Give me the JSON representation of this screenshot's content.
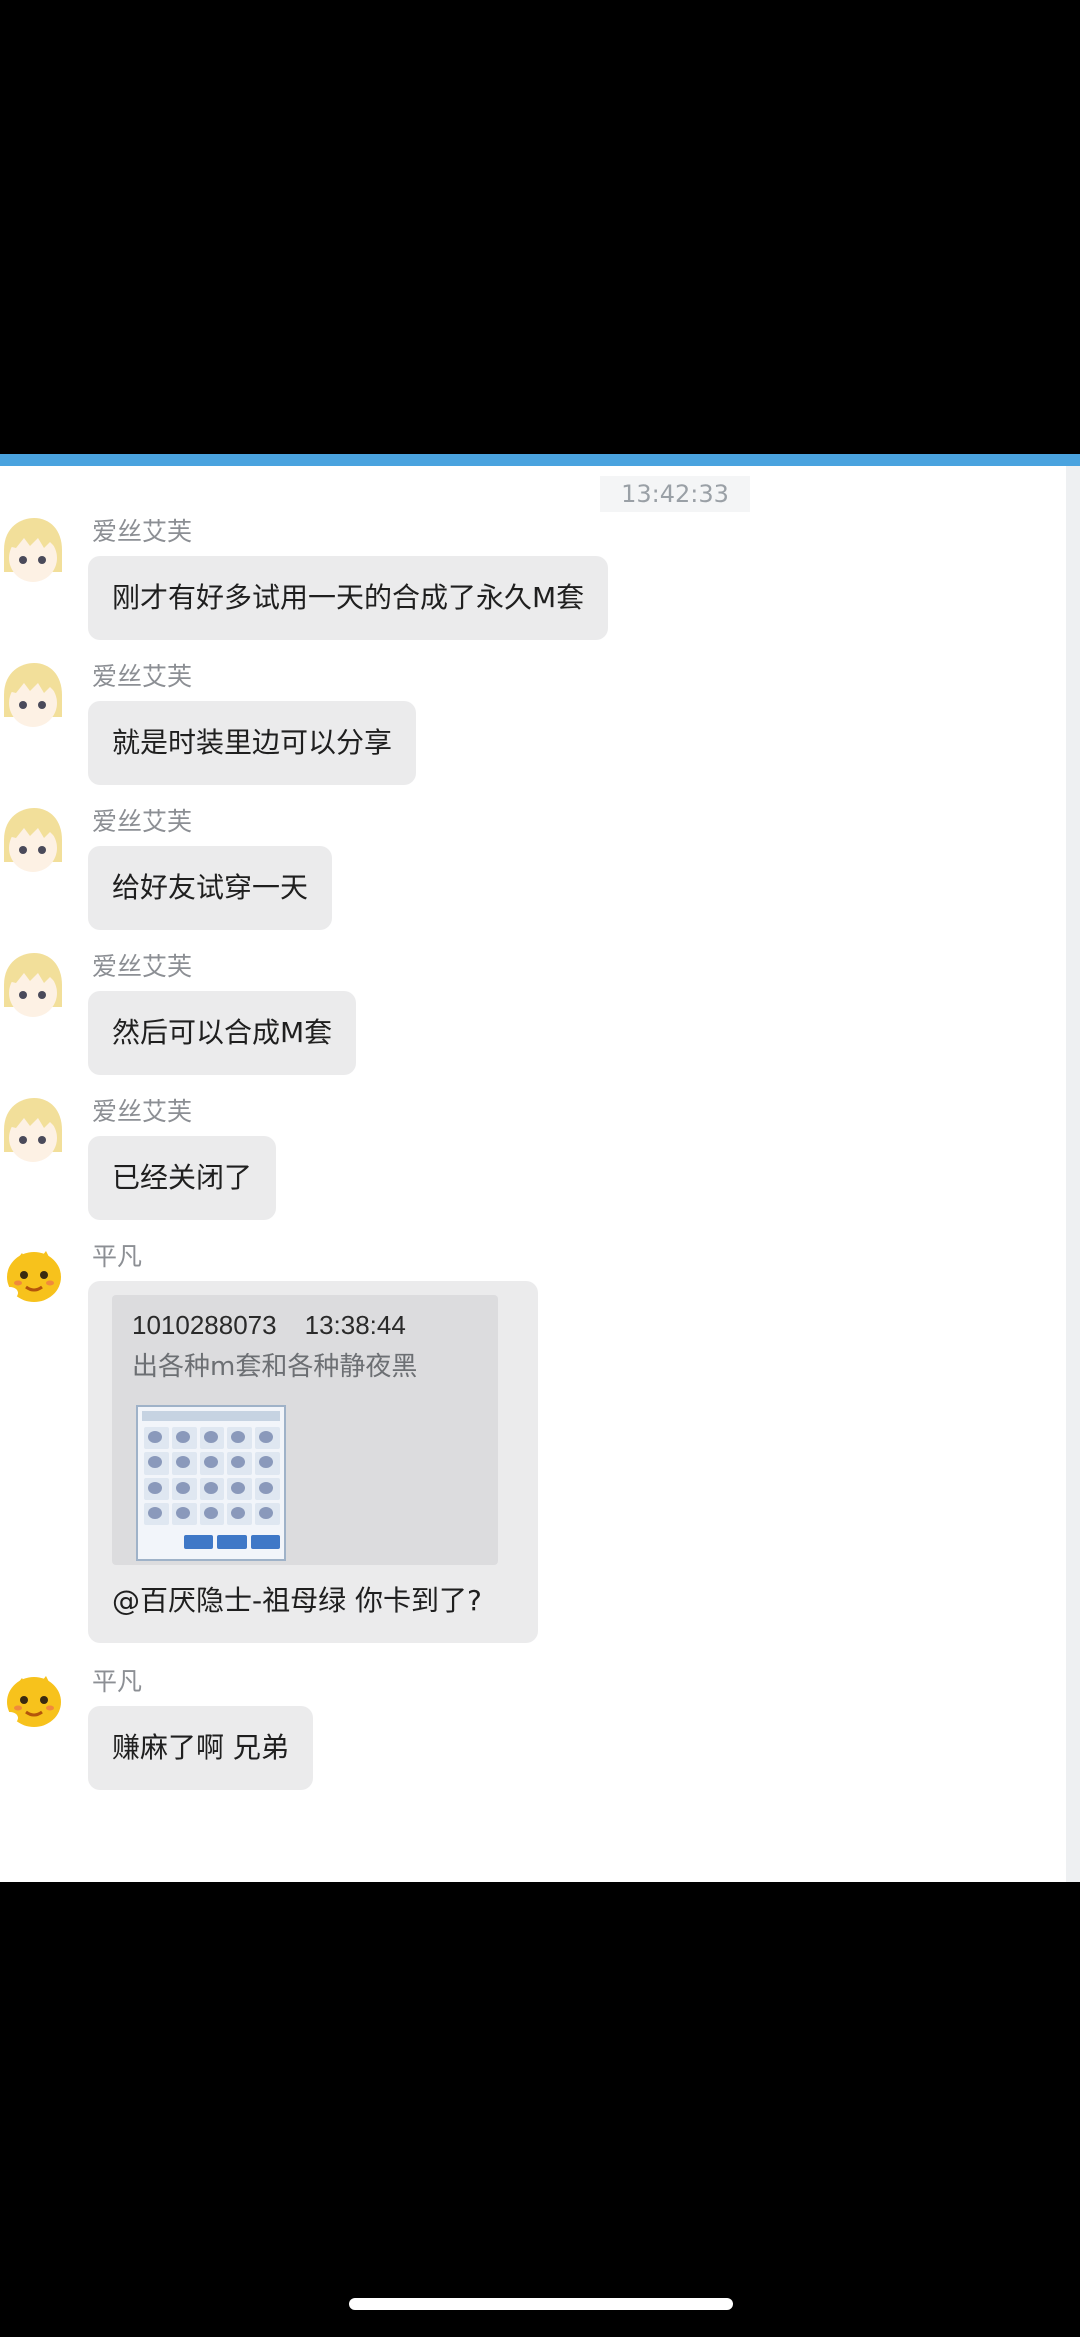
{
  "timestamp": "13:42:33",
  "messages": [
    {
      "sender": "爱丝艾芙",
      "text": "刚才有好多试用一天的合成了永久M套",
      "avatar": "anime-girl-avatar"
    },
    {
      "sender": "爱丝艾芙",
      "text": "就是时装里边可以分享",
      "avatar": "anime-girl-avatar"
    },
    {
      "sender": "爱丝艾芙",
      "text": "给好友试穿一天",
      "avatar": "anime-girl-avatar"
    },
    {
      "sender": "爱丝艾芙",
      "text": "然后可以合成M套",
      "avatar": "anime-girl-avatar"
    },
    {
      "sender": "爱丝艾芙",
      "text": "已经关闭了",
      "avatar": "anime-girl-avatar"
    }
  ],
  "quote_message": {
    "sender": "平凡",
    "avatar": "yellow-emoji-avatar",
    "quoted_id": "1010288073",
    "quoted_time": "13:38:44",
    "quoted_text": "出各种m套和各种静夜黑",
    "reply": "@百厌隐士-祖母绿 你卡到了?"
  },
  "last_message": {
    "sender": "平凡",
    "text": "赚麻了啊 兄弟",
    "avatar": "yellow-emoji-avatar"
  },
  "colors": {
    "accent_stripe": "#4aa3df",
    "bubble": "#ebebec",
    "quote_box": "#dcdcde"
  }
}
